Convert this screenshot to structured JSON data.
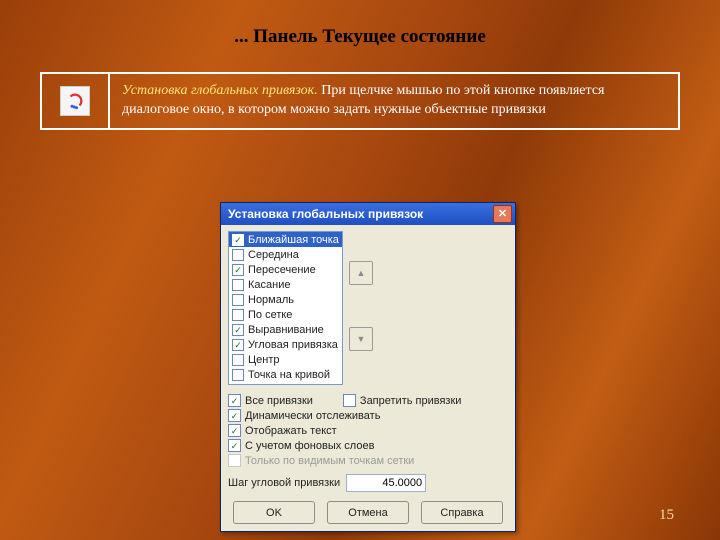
{
  "title": "... Панель Текущее состояние",
  "info": {
    "em": "Установка глобальных привязок.",
    "rest": " При щелчке мышью по этой кнопке появляется диалоговое окно, в котором можно задать нужные объектные привязки"
  },
  "dialog": {
    "title": "Установка глобальных привязок",
    "items": [
      {
        "label": "Ближайшая точка",
        "checked": true,
        "selected": true
      },
      {
        "label": "Середина",
        "checked": false
      },
      {
        "label": "Пересечение",
        "checked": true
      },
      {
        "label": "Касание",
        "checked": false
      },
      {
        "label": "Нормаль",
        "checked": false
      },
      {
        "label": "По сетке",
        "checked": false
      },
      {
        "label": "Выравнивание",
        "checked": true
      },
      {
        "label": "Угловая привязка",
        "checked": true
      },
      {
        "label": "Центр",
        "checked": false
      },
      {
        "label": "Точка на кривой",
        "checked": false
      }
    ],
    "opts": {
      "all": "Все привязки",
      "forbid": "Запретить привязки",
      "dyn": "Динамически отслеживать",
      "text": "Отображать текст",
      "bg": "С учетом фоновых слоев",
      "hidden": "Только по видимым точкам сетки"
    },
    "step_label": "Шаг угловой привязки",
    "step_value": "45.0000",
    "ok": "OK",
    "cancel": "Отмена",
    "help": "Справка"
  },
  "page": "15"
}
